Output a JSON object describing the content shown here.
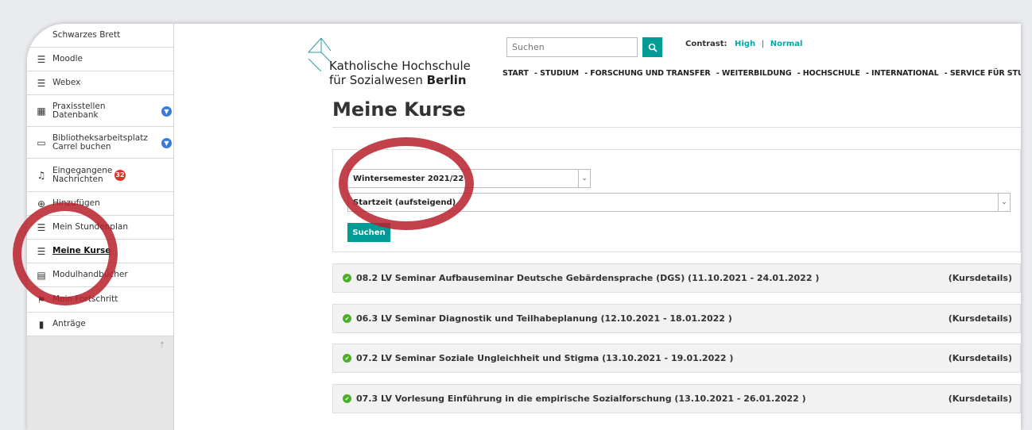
{
  "sidebar": {
    "items": [
      {
        "label": "Schwarzes Brett",
        "icon": "bulletin-icon"
      },
      {
        "label": "Moodle",
        "icon": "list-icon"
      },
      {
        "label": "Webex",
        "icon": "list-icon"
      },
      {
        "label": "Praxisstellen Datenbank",
        "icon": "building-icon"
      },
      {
        "label": "Bibliotheksarbeitsplatz Carrel buchen",
        "icon": "desk-icon"
      },
      {
        "label": "Eingegangene Nachrichten",
        "icon": "bell-icon",
        "badge": "32"
      },
      {
        "label": "Hinzufügen",
        "icon": "plus-circle-icon"
      },
      {
        "label": "Mein Stundenplan",
        "icon": "list-icon"
      },
      {
        "label": "Meine Kurse",
        "icon": "list-icon"
      },
      {
        "label": "Modulhandbücher",
        "icon": "book-icon"
      },
      {
        "label": "Mein Fortschritt",
        "icon": "flag-icon"
      },
      {
        "label": "Anträge",
        "icon": "file-icon"
      }
    ]
  },
  "header": {
    "logo_line1": "Katholische Hochschule",
    "logo_line2_a": "für Sozialwesen ",
    "logo_line2_b": "Berlin",
    "search_placeholder": "Suchen",
    "contrast_label": "Contrast:",
    "contrast_high": "High",
    "contrast_sep": "|",
    "contrast_normal": "Normal",
    "nav": [
      "START",
      "- STUDIUM",
      "- FORSCHUNG UND TRANSFER",
      "- WEITERBILDUNG",
      "- HOCHSCHULE",
      "- INTERNATIONAL",
      "- SERVICE FÜR STUDIERENDE"
    ]
  },
  "main": {
    "title": "Meine Kurse",
    "semester_select": "Wintersemester 2021/22",
    "sort_select": "Startzeit (aufsteigend)",
    "search_button": "Suchen",
    "courses": [
      {
        "title": "08.2 LV Seminar Aufbauseminar Deutsche Gebärdensprache (DGS) (11.10.2021 - 24.01.2022 )",
        "details": "(Kursdetails)"
      },
      {
        "title": "06.3 LV Seminar Diagnostik und Teilhabeplanung (12.10.2021 - 18.01.2022 )",
        "details": "(Kursdetails)"
      },
      {
        "title": "07.2 LV Seminar Soziale Ungleichheit und Stigma (13.10.2021 - 19.01.2022 )",
        "details": "(Kursdetails)"
      },
      {
        "title": "07.3 LV Vorlesung Einführung in die empirische Sozialforschung (13.10.2021 - 26.01.2022 )",
        "details": "(Kursdetails)"
      }
    ]
  },
  "colors": {
    "accent": "#009b96",
    "annotation": "#b8202a",
    "badge": "#d9342b"
  }
}
